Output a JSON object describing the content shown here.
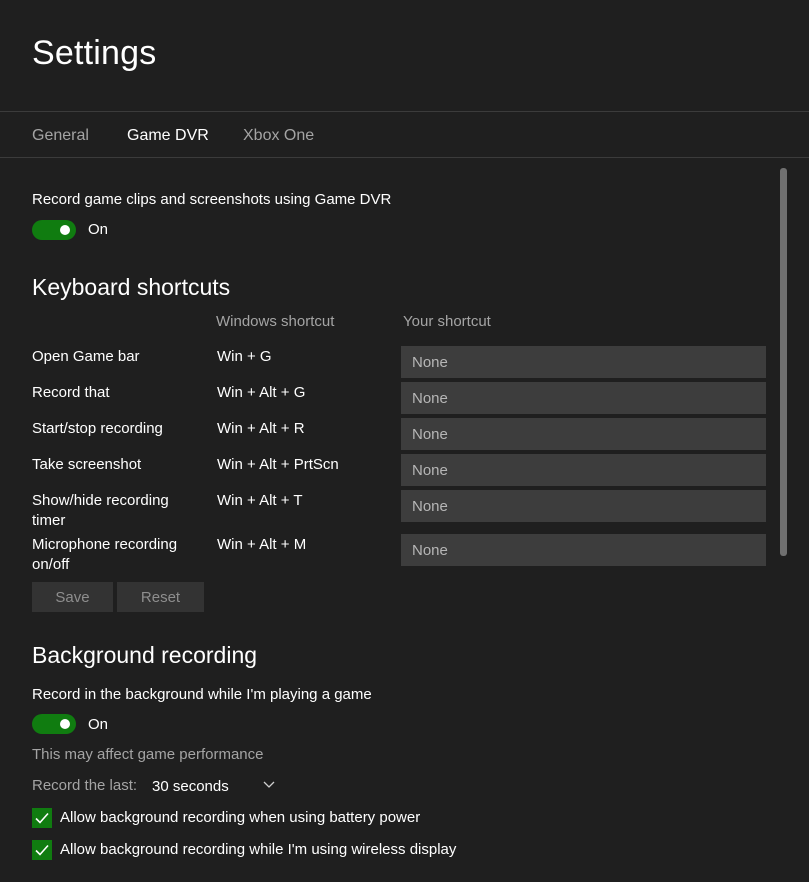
{
  "header": {
    "title": "Settings"
  },
  "tabs": [
    {
      "label": "General",
      "active": false
    },
    {
      "label": "Game DVR",
      "active": true
    },
    {
      "label": "Xbox One",
      "active": false
    }
  ],
  "game_dvr": {
    "record_label": "Record game clips and screenshots using Game DVR",
    "record_state": "On"
  },
  "keyboard_shortcuts": {
    "title": "Keyboard shortcuts",
    "col_windows": "Windows shortcut",
    "col_yours": "Your shortcut",
    "rows": [
      {
        "action": "Open Game bar",
        "windows": "Win + G",
        "placeholder": "None"
      },
      {
        "action": "Record that",
        "windows": "Win + Alt + G",
        "placeholder": "None"
      },
      {
        "action": "Start/stop recording",
        "windows": "Win + Alt + R",
        "placeholder": "None"
      },
      {
        "action": "Take screenshot",
        "windows": "Win + Alt + PrtScn",
        "placeholder": "None"
      },
      {
        "action": "Show/hide recording timer",
        "windows": "Win + Alt + T",
        "placeholder": "None"
      },
      {
        "action": "Microphone recording on/off",
        "windows": "Win + Alt + M",
        "placeholder": "None"
      }
    ],
    "save_label": "Save",
    "reset_label": "Reset"
  },
  "background_recording": {
    "title": "Background recording",
    "record_label": "Record in the background while I'm playing a game",
    "record_state": "On",
    "note": "This may affect game performance",
    "record_last_label": "Record the last:",
    "record_last_value": "30 seconds",
    "battery_label": "Allow background recording when using battery power",
    "wireless_label": "Allow background recording while I'm using wireless display"
  },
  "colors": {
    "background": "#1f1f1f",
    "accent": "#107c10",
    "input_bg": "#3d3d3d"
  }
}
